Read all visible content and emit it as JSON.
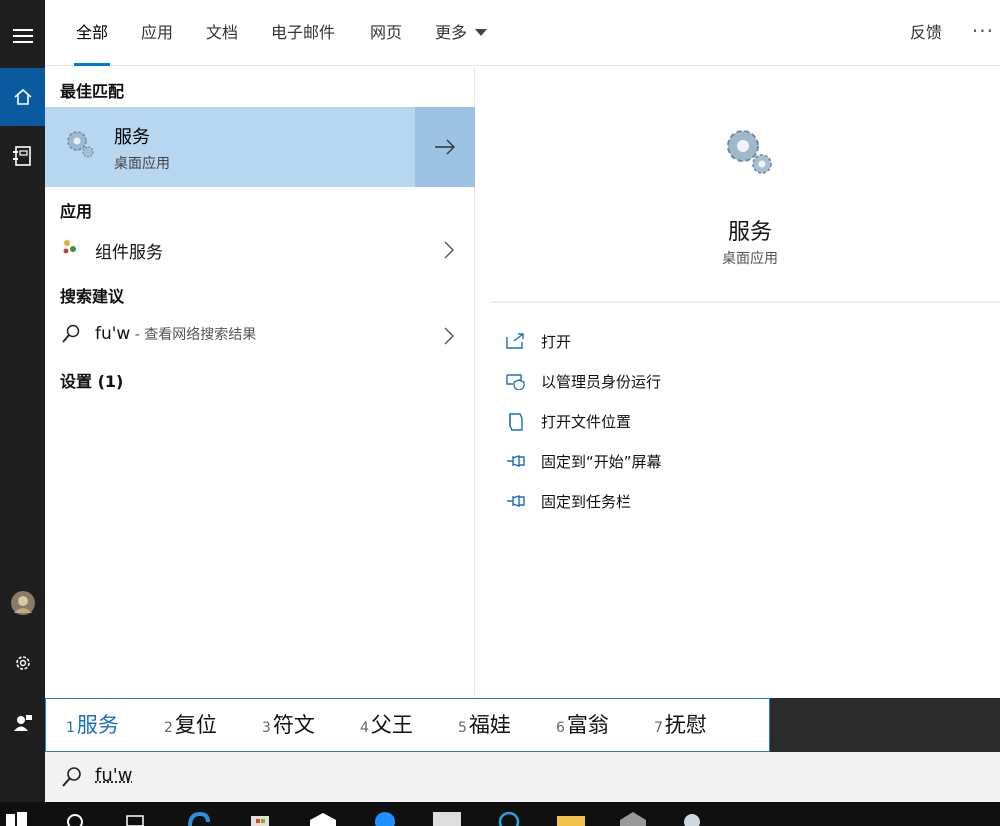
{
  "tabs": [
    {
      "label": "全部",
      "active": true
    },
    {
      "label": "应用"
    },
    {
      "label": "文档"
    },
    {
      "label": "电子邮件"
    },
    {
      "label": "网页"
    },
    {
      "label": "更多"
    }
  ],
  "header": {
    "feedback_label": "反馈",
    "more_options": "···"
  },
  "results": {
    "best_match_header": "最佳匹配",
    "best_match": {
      "title": "服务",
      "subtitle": "桌面应用"
    },
    "apps_header": "应用",
    "apps": [
      {
        "label": "组件服务"
      }
    ],
    "suggestions_header": "搜索建议",
    "suggestion": {
      "query": "fu'w",
      "hint": " - 查看网络搜索结果"
    },
    "settings_header": "设置 (1)"
  },
  "preview": {
    "title": "服务",
    "subtitle": "桌面应用",
    "actions": [
      {
        "label": "打开",
        "icon": "open-icon"
      },
      {
        "label": "以管理员身份运行",
        "icon": "shield-icon"
      },
      {
        "label": "打开文件位置",
        "icon": "file-location-icon"
      },
      {
        "label": "固定到“开始”屏幕",
        "icon": "pin-icon"
      },
      {
        "label": "固定到任务栏",
        "icon": "pin-icon"
      }
    ]
  },
  "ime": {
    "candidates": [
      {
        "num": "1",
        "word": "服务",
        "selected": true
      },
      {
        "num": "2",
        "word": "复位"
      },
      {
        "num": "3",
        "word": "符文"
      },
      {
        "num": "4",
        "word": "父王"
      },
      {
        "num": "5",
        "word": "福娃"
      },
      {
        "num": "6",
        "word": "富翁"
      },
      {
        "num": "7",
        "word": "抚慰"
      }
    ]
  },
  "search": {
    "value": "fu'w"
  },
  "colors": {
    "accent": "#0078d7",
    "selection": "#b7d6ef",
    "rail": "#1f1f1f",
    "rail_active": "#0a5aa0"
  }
}
